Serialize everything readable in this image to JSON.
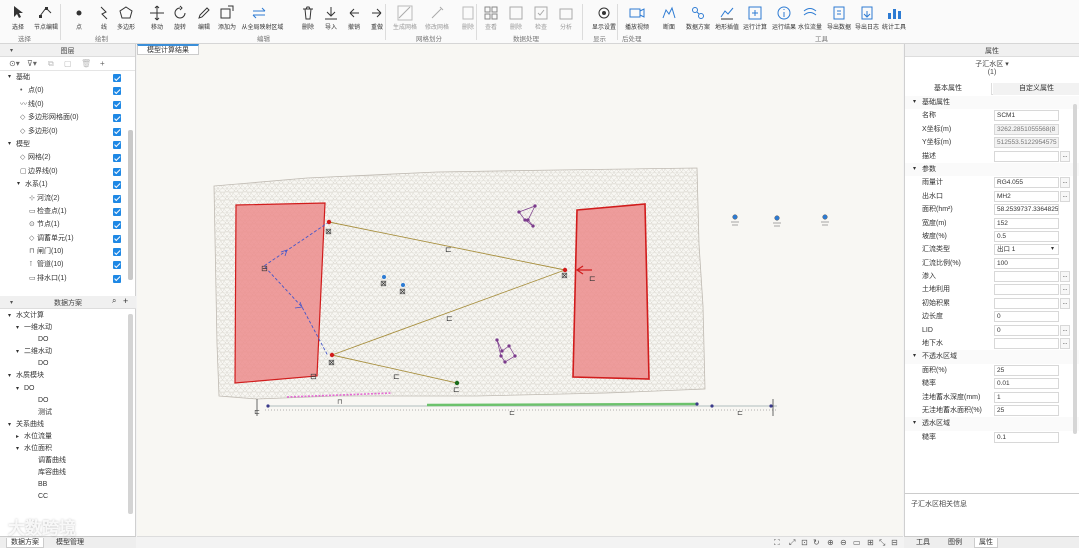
{
  "ribbon": {
    "buttons": [
      {
        "label": "选择",
        "icon": "cursor-icon"
      },
      {
        "label": "节点编辑",
        "icon": "node-edit-icon"
      },
      {
        "label": "点",
        "icon": "point-icon"
      },
      {
        "label": "线",
        "icon": "line-icon"
      },
      {
        "label": "多边形",
        "icon": "polygon-icon"
      },
      {
        "label": "移动",
        "icon": "move-icon"
      },
      {
        "label": "旋转",
        "icon": "rotate-icon"
      },
      {
        "label": "编辑",
        "icon": "pencil-icon"
      },
      {
        "label": "添加为",
        "icon": "add-as-icon"
      },
      {
        "label": "从全局映射区域",
        "icon": "map-region-icon"
      },
      {
        "label": "删除",
        "icon": "delete-icon"
      },
      {
        "label": "导入",
        "icon": "import-icon"
      },
      {
        "label": "撤销",
        "icon": "undo-icon"
      },
      {
        "label": "重做",
        "icon": "redo-icon"
      },
      {
        "label": "生成网格",
        "icon": "mesh-generate-icon"
      },
      {
        "label": "修改网格",
        "icon": "mesh-modify-icon"
      },
      {
        "label": "删除",
        "icon": "mesh-delete-icon"
      },
      {
        "label": "查看",
        "icon": "grid-view-icon"
      },
      {
        "label": "删除",
        "icon": "grid-delete-icon"
      },
      {
        "label": "检查",
        "icon": "grid-check-icon"
      },
      {
        "label": "分析",
        "icon": "grid-analyze-icon"
      },
      {
        "label": "显示设置",
        "icon": "display-settings-icon"
      },
      {
        "label": "播放视频",
        "icon": "video-icon"
      },
      {
        "label": "断面",
        "icon": "section-icon"
      },
      {
        "label": "数据方案",
        "icon": "data-scheme-icon"
      },
      {
        "label": "地形插值",
        "icon": "terrain-interp-icon"
      },
      {
        "label": "运行计算",
        "icon": "run-icon"
      },
      {
        "label": "运行结果",
        "icon": "result-info-icon"
      },
      {
        "label": "水位流量",
        "icon": "water-flow-icon"
      },
      {
        "label": "导出数据",
        "icon": "export-data-icon"
      },
      {
        "label": "导出日志",
        "icon": "export-log-icon"
      },
      {
        "label": "统计工具",
        "icon": "stats-tool-icon"
      }
    ],
    "groups": [
      "选择",
      "绘制",
      "编辑",
      "网格划分",
      "数据处理",
      "显示",
      "后处理",
      "工具"
    ]
  },
  "left_panel": {
    "title": "图层",
    "layers": [
      {
        "label": "基础",
        "level": 0,
        "expand": "▾"
      },
      {
        "label": "点(0)",
        "level": 1,
        "prefix": "•"
      },
      {
        "label": "线(0)",
        "level": 1,
        "prefix": "〰"
      },
      {
        "label": "多边形网格面(0)",
        "level": 1,
        "prefix": "◇"
      },
      {
        "label": "多边形(0)",
        "level": 1,
        "prefix": "◇"
      },
      {
        "label": "模型",
        "level": 0,
        "expand": "▾"
      },
      {
        "label": "网格(2)",
        "level": 1,
        "prefix": "◇"
      },
      {
        "label": "边界线(0)",
        "level": 1,
        "prefix": "▢"
      },
      {
        "label": "水系(1)",
        "level": 1,
        "expand": "▾"
      },
      {
        "label": "河流(2)",
        "level": 2,
        "prefix": "⊹"
      },
      {
        "label": "检查点(1)",
        "level": 2,
        "prefix": "▭"
      },
      {
        "label": "节点(1)",
        "level": 2,
        "prefix": "⊙"
      },
      {
        "label": "调蓄单元(1)",
        "level": 2,
        "prefix": "◇"
      },
      {
        "label": "闸门(10)",
        "level": 2,
        "prefix": "⊓"
      },
      {
        "label": "管道(10)",
        "level": 2,
        "prefix": "⊺"
      },
      {
        "label": "排水口(1)",
        "level": 2,
        "prefix": "▭"
      }
    ],
    "scheme_title": "数据方案",
    "scheme_tree": [
      {
        "label": "水文计算",
        "level": 0,
        "expand": "▾"
      },
      {
        "label": "一维水动",
        "level": 1,
        "expand": "▾"
      },
      {
        "label": "DO",
        "level": 2
      },
      {
        "label": "二维水动",
        "level": 1,
        "expand": "▾"
      },
      {
        "label": "DO",
        "level": 2
      },
      {
        "label": "水质模块",
        "level": 0,
        "expand": "▾"
      },
      {
        "label": "DO",
        "level": 1,
        "expand": "▾"
      },
      {
        "label": "DO",
        "level": 2
      },
      {
        "label": "测试",
        "level": 2
      },
      {
        "label": "关系曲线",
        "level": 0,
        "expand": "▾"
      },
      {
        "label": "水位流量",
        "level": 1,
        "expand": "▸"
      },
      {
        "label": "水位面积",
        "level": 1,
        "expand": "▾"
      },
      {
        "label": "调蓄曲线",
        "level": 2
      },
      {
        "label": "库容曲线",
        "level": 2
      },
      {
        "label": "BB",
        "level": 2
      },
      {
        "label": "CC",
        "level": 2
      }
    ],
    "bottom_tabs": [
      "数据方案",
      "模型管理"
    ]
  },
  "canvas": {
    "tab_label": "模型计算结果",
    "status_icons": [
      "⛶",
      "⤢",
      "⊡",
      "↻",
      "⊕",
      "⊖",
      "▭",
      "⊞",
      "⤡",
      "⊟"
    ]
  },
  "right_panel": {
    "header": "属性",
    "subtitle": "子汇水区 ▾",
    "count": "(1)",
    "tabs": [
      "基本属性",
      "自定义属性"
    ],
    "sections": [
      {
        "title": "基础属性",
        "rows": [
          {
            "k": "名称",
            "v": "SCM1",
            "ro": false
          },
          {
            "k": "X坐标(m)",
            "v": "3262.2851055568(8",
            "ro": true
          },
          {
            "k": "Y坐标(m)",
            "v": "512553.5122954575",
            "ro": true
          },
          {
            "k": "描述",
            "v": "",
            "ro": false,
            "btn": "..."
          }
        ]
      },
      {
        "title": "参数",
        "rows": [
          {
            "k": "雨量计",
            "v": "RG4.055",
            "ro": false,
            "btn": "..."
          },
          {
            "k": "出水口",
            "v": "MH2",
            "ro": false,
            "btn": "..."
          },
          {
            "k": "面积(hm²)",
            "v": "58.2539737.3364825",
            "ro": false
          },
          {
            "k": "宽度(m)",
            "v": "152",
            "ro": false
          },
          {
            "k": "坡度(%)",
            "v": "0.5",
            "ro": false
          },
          {
            "k": "汇流类型",
            "v": "出口 1",
            "ro": false,
            "select": true
          },
          {
            "k": "汇流比例(%)",
            "v": "100",
            "ro": false
          },
          {
            "k": "渗入",
            "v": "",
            "ro": false,
            "btn": "..."
          },
          {
            "k": "土地利用",
            "v": "",
            "ro": false,
            "btn": "..."
          },
          {
            "k": "初始积累",
            "v": "",
            "ro": false,
            "btn": "..."
          },
          {
            "k": "边长度",
            "v": "0",
            "ro": false
          },
          {
            "k": "LID",
            "v": "0",
            "ro": false,
            "btn": "..."
          },
          {
            "k": "地下水",
            "v": "",
            "ro": false,
            "btn": "..."
          }
        ]
      },
      {
        "title": "不透水区域",
        "rows": [
          {
            "k": "面积(%)",
            "v": "25",
            "ro": false
          },
          {
            "k": "糙率",
            "v": "0.01",
            "ro": false
          },
          {
            "k": "洼地蓄水深度(mm)",
            "v": "1",
            "ro": false
          },
          {
            "k": "无洼地蓄水面积(%)",
            "v": "25",
            "ro": false
          }
        ]
      },
      {
        "title": "透水区域",
        "rows": [
          {
            "k": "糙率",
            "v": "0.1",
            "ro": false
          }
        ]
      }
    ],
    "description": "子汇水区相关信息",
    "bottom_tabs": [
      "工具",
      "图例",
      "属性"
    ]
  },
  "watermark": "大数跨境",
  "colors": {
    "accent": "#1e88e5",
    "polygon_fill": "#ec8c8c",
    "polygon_stroke": "#d11c1c",
    "mesh": "#d9d6d0"
  }
}
